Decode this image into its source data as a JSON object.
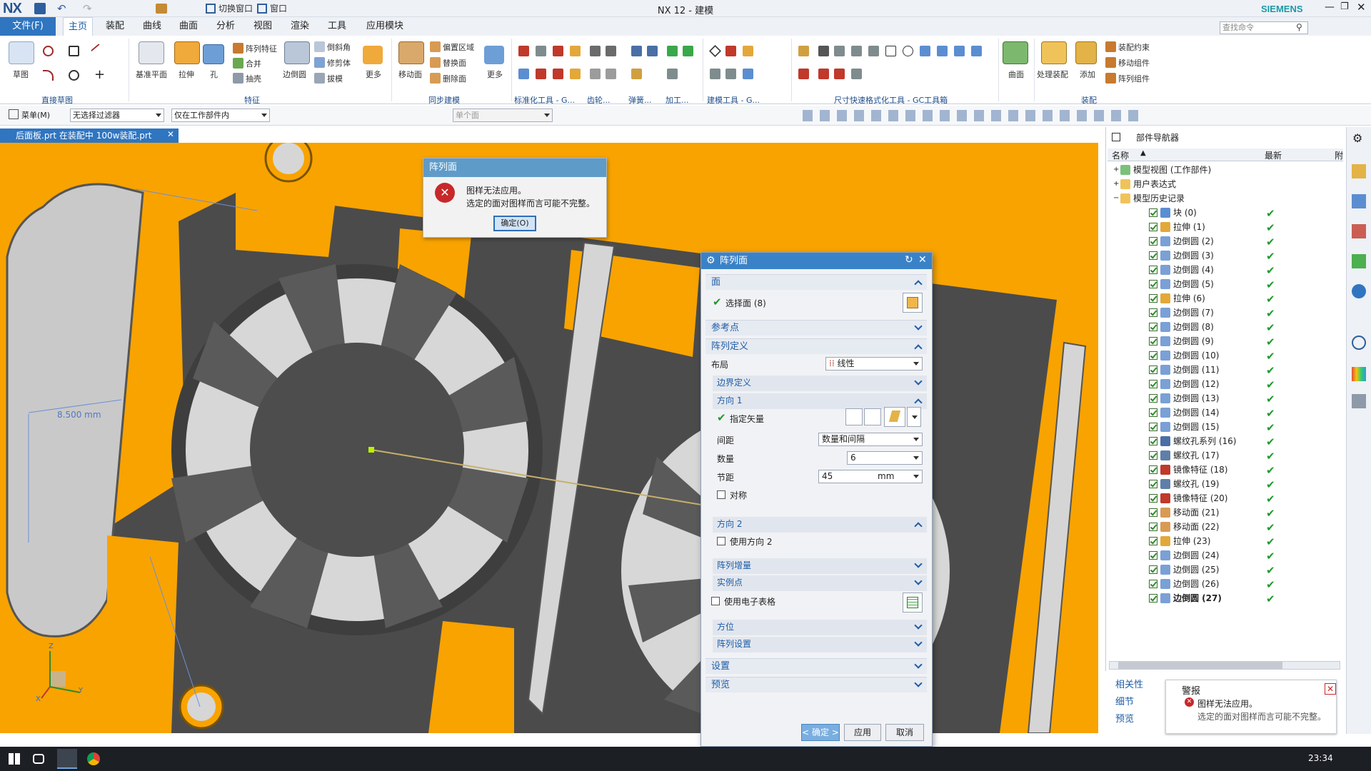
{
  "app": {
    "logo": "NX",
    "title": "NX 12 - 建模",
    "brand": "SIEMENS",
    "search_placeholder": "查找命令"
  },
  "quick_access": {
    "switch_window": "切换窗口",
    "window": "窗口"
  },
  "tabs": {
    "file": "文件(F)",
    "items": [
      "主页",
      "装配",
      "曲线",
      "曲面",
      "分析",
      "视图",
      "渲染",
      "工具",
      "应用模块"
    ],
    "active": "主页"
  },
  "ribbon": {
    "sketch": "草图",
    "direct_sketch_group": "直接草图",
    "datum_plane": "基准平面",
    "extrude": "拉伸",
    "hole": "孔",
    "pattern_feature": "阵列特征",
    "unite": "合并",
    "shell": "抽壳",
    "edge_blend": "边倒圆",
    "chamfer": "倒斜角",
    "trim_body": "修剪体",
    "draft": "拔模",
    "more1": "更多",
    "feature_group": "特征",
    "move_face": "移动面",
    "offset_region": "偏置区域",
    "replace_face": "替换面",
    "delete_face": "删除面",
    "more2": "更多",
    "sync_group": "同步建模",
    "std_tools_group": "标准化工具 - G...",
    "gear_group": "齿轮...",
    "spring_group": "弹簧...",
    "machining_group": "加工...",
    "modeling_tools_group": "建模工具 - G...",
    "dim_format_group": "尺寸快速格式化工具 - GC工具箱",
    "surface": "曲面",
    "process_assembly": "处理装配",
    "add": "添加",
    "assembly_constraint": "装配约束",
    "move_component": "移动组件",
    "array_component": "阵列组件",
    "assembly_group": "装配"
  },
  "commandbar": {
    "menu": "菜单(M)",
    "filter": "无选择过滤器",
    "scope": "仅在工作部件内",
    "single_face": "单个面"
  },
  "document_tab": "后面板.prt 在装配中 100w装配.prt",
  "viewport": {
    "dimension": "8.500 mm",
    "axis_z": "Z",
    "axis_y": "Y",
    "axis_x": "X"
  },
  "error_popup": {
    "title": "阵列面",
    "line1": "图样无法应用。",
    "line2": "选定的面对图样而言可能不完整。",
    "ok": "确定(O)"
  },
  "dialog": {
    "title": "阵列面",
    "sec_face": "面",
    "select_face": "选择面 (8)",
    "sec_reference": "参考点",
    "sec_pattern_def": "阵列定义",
    "layout_label": "布局",
    "layout_value": "线性",
    "boundary_def": "边界定义",
    "direction1": "方向 1",
    "specify_vector": "指定矢量",
    "spacing_label": "间距",
    "spacing_value": "数量和间隔",
    "count_label": "数量",
    "count_value": "6",
    "pitch_label": "节距",
    "pitch_value": "45",
    "pitch_unit": "mm",
    "symmetric": "对称",
    "direction2": "方向 2",
    "use_direction2": "使用方向 2",
    "pattern_increment": "阵列增量",
    "instance_point": "实例点",
    "use_spreadsheet": "使用电子表格",
    "orientation": "方位",
    "pattern_settings": "阵列设置",
    "settings": "设置",
    "preview": "预览",
    "ok": "< 确定 >",
    "apply": "应用",
    "cancel": "取消"
  },
  "navigator": {
    "title": "部件导航器",
    "col_name": "名称",
    "col_latest": "最新",
    "col_extra": "附",
    "roots": [
      "模型视图 (工作部件)",
      "用户表达式",
      "模型历史记录"
    ],
    "features": [
      {
        "name": "块 (0)",
        "icon": "block"
      },
      {
        "name": "拉伸 (1)",
        "icon": "extrude"
      },
      {
        "name": "边倒圆 (2)",
        "icon": "blend"
      },
      {
        "name": "边倒圆 (3)",
        "icon": "blend"
      },
      {
        "name": "边倒圆 (4)",
        "icon": "blend"
      },
      {
        "name": "边倒圆 (5)",
        "icon": "blend"
      },
      {
        "name": "拉伸 (6)",
        "icon": "extrude"
      },
      {
        "name": "边倒圆 (7)",
        "icon": "blend"
      },
      {
        "name": "边倒圆 (8)",
        "icon": "blend"
      },
      {
        "name": "边倒圆 (9)",
        "icon": "blend"
      },
      {
        "name": "边倒圆 (10)",
        "icon": "blend"
      },
      {
        "name": "边倒圆 (11)",
        "icon": "blend"
      },
      {
        "name": "边倒圆 (12)",
        "icon": "blend"
      },
      {
        "name": "边倒圆 (13)",
        "icon": "blend"
      },
      {
        "name": "边倒圆 (14)",
        "icon": "blend"
      },
      {
        "name": "边倒圆 (15)",
        "icon": "blend"
      },
      {
        "name": "螺纹孔系列 (16)",
        "icon": "hole-series"
      },
      {
        "name": "螺纹孔 (17)",
        "icon": "hole"
      },
      {
        "name": "镜像特征 (18)",
        "icon": "mirror"
      },
      {
        "name": "螺纹孔 (19)",
        "icon": "hole"
      },
      {
        "name": "镜像特征 (20)",
        "icon": "mirror"
      },
      {
        "name": "移动面 (21)",
        "icon": "move-face"
      },
      {
        "name": "移动面 (22)",
        "icon": "move-face"
      },
      {
        "name": "拉伸 (23)",
        "icon": "extrude"
      },
      {
        "name": "边倒圆 (24)",
        "icon": "blend"
      },
      {
        "name": "边倒圆 (25)",
        "icon": "blend"
      },
      {
        "name": "边倒圆 (26)",
        "icon": "blend"
      },
      {
        "name": "边倒圆 (27)",
        "icon": "blend"
      }
    ],
    "bottom_tabs": [
      "相关性",
      "细节",
      "预览"
    ],
    "alert_title": "警报",
    "alert_line1": "图样无法应用。",
    "alert_line2": "选定的面对图样而言可能不完整。"
  },
  "taskbar": {
    "time": "23:34"
  },
  "colors": {
    "accent": "#2f75c0",
    "viewport_bg": "#f8a300",
    "part_gray": "#4b4b4b",
    "ok_green": "#1f9a2c"
  }
}
